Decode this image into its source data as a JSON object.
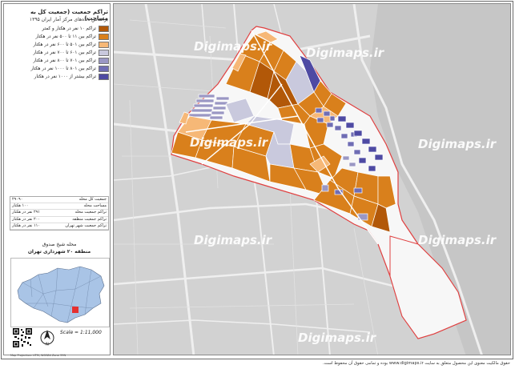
{
  "panel": {
    "title": "تراکم جمعیت (جمعیت کل به مساحت)",
    "subtitle": "براساس داده‌های مرکز آمار ایران ۱۳۹۵",
    "legend": [
      {
        "label": "تراکم ۱۰ نفر در هکتار و کمتر",
        "color": "#b25808"
      },
      {
        "label": "تراکم بین ۱۱ تا ۵۰۰ نفر در هکتار",
        "color": "#d9801c"
      },
      {
        "label": "تراکم بین ۵۰۱ تا ۶۰۰ نفر در هکتار",
        "color": "#f6b877"
      },
      {
        "label": "تراکم بین ۶۰۱ تا ۷۰۰ نفر در هکتار",
        "color": "#c9c9dd"
      },
      {
        "label": "تراکم بین ۷۰۱ تا ۸۰۰ نفر در هکتار",
        "color": "#9a97c4"
      },
      {
        "label": "تراکم بین ۸۰۱ تا ۱۰۰۰ نفر در هکتار",
        "color": "#6f6db4"
      },
      {
        "label": "تراکم بیشتر از ۱۰۰۰ نفر در هکتار",
        "color": "#4e4aa3"
      }
    ],
    "stats": [
      {
        "label": "جمعیت کل محله",
        "value": "۲۹۰۹۰"
      },
      {
        "label": "مساحت محله",
        "value": "۱۰۰ هکتار"
      },
      {
        "label": "تراکم جمعیت محله",
        "value": "۲۹۱ نفر در هکتار"
      },
      {
        "label": "تراکم جمعیت منطقه",
        "value": "۲۰۰ نفر در هکتار"
      },
      {
        "label": "تراکم جمعیت شهر تهران",
        "value": "۱۱۰ نفر در هکتار"
      }
    ],
    "neighborhood": "محله شیخ صدوق",
    "district": "منطقه ۲۰ شهرداری تهران",
    "scale": "Scale = 1:11,000",
    "footer": "Map Projection: UTM, WGS84 Zone 39N"
  },
  "watermark": "Digimaps.ir",
  "copyright": "حقوق مالکیت معنوی این محصول متعلق به سایت www.digimaps.ir بوده و تمامی حقوق آن محفوظ است.",
  "colors": {
    "ocre_dark": "#b25808",
    "ocre": "#d9801c",
    "peach": "#f6b877",
    "lavender": "#c9c9dd",
    "violet": "#9a97c4",
    "purple": "#6f6db4",
    "indigo": "#4e4aa3",
    "boundary": "#e04040",
    "road": "#f2f2f2"
  }
}
